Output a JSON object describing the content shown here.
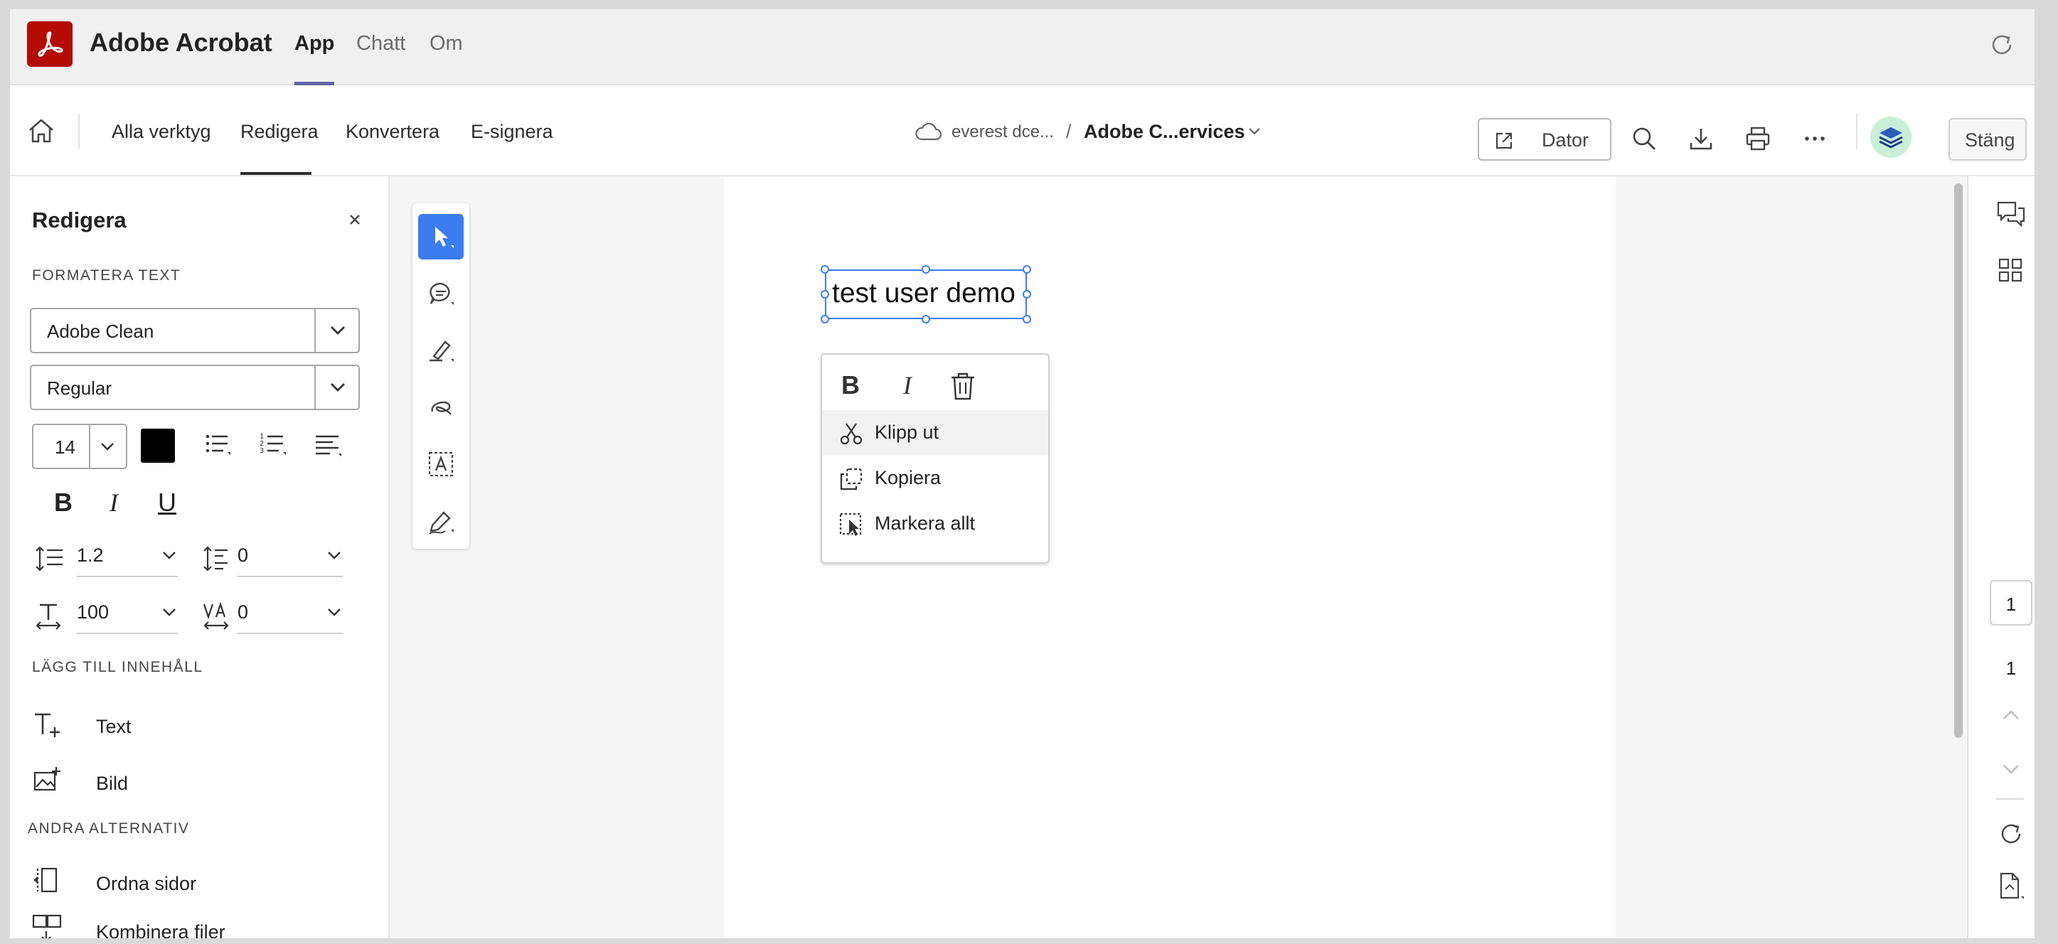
{
  "app": {
    "name": "Adobe Acrobat",
    "tabs": [
      {
        "label": "App",
        "active": true
      },
      {
        "label": "Chatt",
        "active": false
      },
      {
        "label": "Om",
        "active": false
      }
    ]
  },
  "toolbar": {
    "tabs": [
      {
        "label": "Alla verktyg"
      },
      {
        "label": "Redigera",
        "active": true
      },
      {
        "label": "Konvertera"
      },
      {
        "label": "E-signera"
      }
    ],
    "breadcrumb": {
      "location": "everest dce...",
      "separator": "/",
      "file": "Adobe C...ervices"
    },
    "dator_label": "Dator",
    "close_label": "Stäng"
  },
  "left_panel": {
    "title": "Redigera",
    "format_section": "FORMATERA TEXT",
    "font_family": "Adobe Clean",
    "font_style": "Regular",
    "font_size": "14",
    "text_color": "#000000",
    "format_buttons": {
      "bold": "B",
      "italic": "I",
      "underline": "U"
    },
    "line_spacing": "1.2",
    "paragraph_spacing": "0",
    "horizontal_scale": "100",
    "character_spacing": "0",
    "add_section": "LÄGG TILL INNEHÅLL",
    "add_items": [
      {
        "label": "Text"
      },
      {
        "label": "Bild"
      }
    ],
    "other_section": "ANDRA ALTERNATIV",
    "other_items": [
      {
        "label": "Ordna sidor"
      },
      {
        "label": "Kombinera filer"
      }
    ]
  },
  "document": {
    "selected_text": "test user demo"
  },
  "context_menu": {
    "format": {
      "bold": "B",
      "italic": "I"
    },
    "items": [
      {
        "label": "Klipp ut",
        "icon": "scissors-icon"
      },
      {
        "label": "Kopiera",
        "icon": "copy-icon"
      },
      {
        "label": "Markera allt",
        "icon": "select-all-icon"
      }
    ]
  },
  "page_nav": {
    "current": "1",
    "total": "1"
  },
  "colors": {
    "accent": "#3b7cf0",
    "brand": "#b30b00",
    "teams_tab": "#6264a7"
  }
}
